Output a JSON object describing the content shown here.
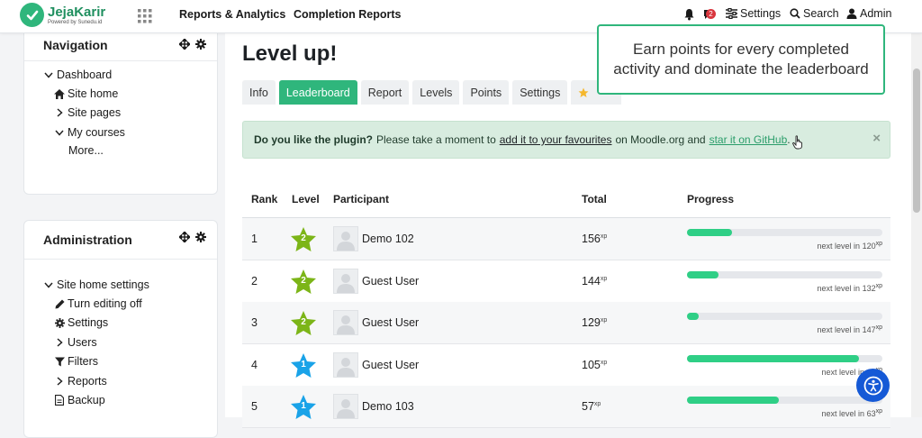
{
  "navbar": {
    "logo_name": "JejaKarir",
    "logo_tagline": "Powered by Sunedu.id",
    "links": [
      "Reports & Analytics",
      "Completion Reports"
    ],
    "notification_count": "2",
    "settings_label": "Settings",
    "search_label": "Search",
    "user_label": "Admin"
  },
  "navigation_block": {
    "title": "Navigation",
    "items": [
      "Dashboard",
      "Site home",
      "Site pages",
      "My courses",
      "More..."
    ]
  },
  "administration_block": {
    "title": "Administration",
    "items": [
      "Site home settings",
      "Turn editing off",
      "Settings",
      "Users",
      "Filters",
      "Reports",
      "Backup"
    ]
  },
  "main": {
    "title": "Level up!",
    "tabs": [
      "Info",
      "Leaderboard",
      "Report",
      "Levels",
      "Points",
      "Settings"
    ],
    "active_tab": "Leaderboard",
    "tooltip": "Earn points for every completed activity and dominate the leaderboard",
    "alert": {
      "strong": "Do you like the plugin?",
      "text1": "Please take a moment to",
      "link1": "add it to your favourites",
      "text2": "on Moodle.org and",
      "link2": "star it on GitHub",
      "text3": ".",
      "close": "×"
    }
  },
  "leaderboard": {
    "headers": [
      "Rank",
      "Level",
      "Participant",
      "Total",
      "Progress"
    ],
    "rows": [
      {
        "rank": "1",
        "level": "2",
        "name": "Demo 102",
        "total": "156",
        "progress": 0.23,
        "next": "next level in",
        "next_xp": "120"
      },
      {
        "rank": "2",
        "level": "2",
        "name": "Guest User",
        "total": "144",
        "progress": 0.16,
        "next": "next level in",
        "next_xp": "132"
      },
      {
        "rank": "3",
        "level": "2",
        "name": "Guest User",
        "total": "129",
        "progress": 0.06,
        "next": "next level in",
        "next_xp": "147"
      },
      {
        "rank": "4",
        "level": "1",
        "name": "Guest User",
        "total": "105",
        "progress": 0.88,
        "next": "next level in",
        "next_xp": "15"
      },
      {
        "rank": "5",
        "level": "1",
        "name": "Demo 103",
        "total": "57",
        "progress": 0.47,
        "next": "next level in",
        "next_xp": "63"
      }
    ],
    "xp_unit": "xp",
    "level_colors": {
      "2": "#7cb518",
      "1": "#1aa3e8"
    }
  }
}
